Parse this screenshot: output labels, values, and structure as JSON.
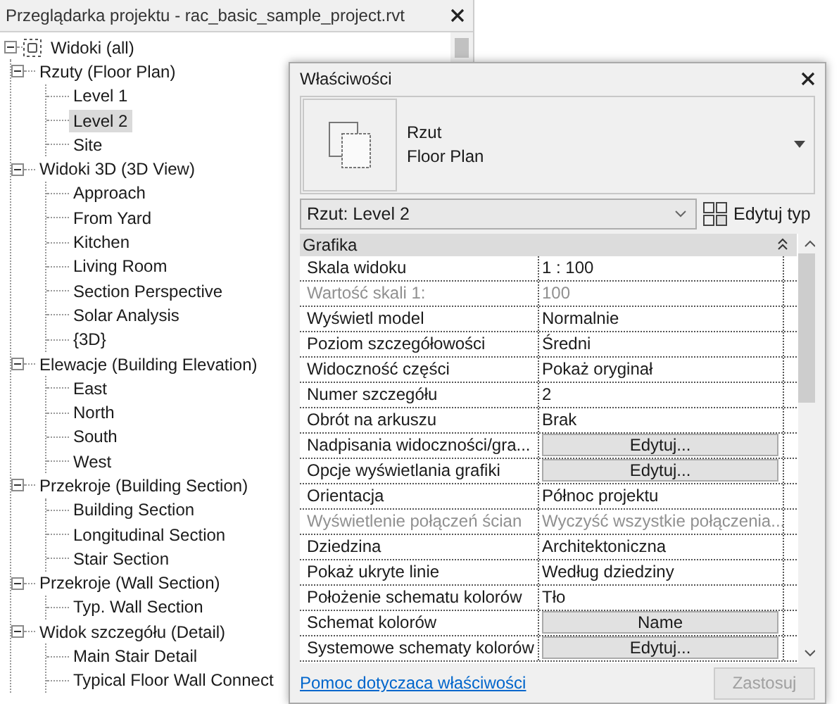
{
  "browser": {
    "title": "Przeglądarka projektu - rac_basic_sample_project.rvt",
    "tree": [
      {
        "label": "Widoki (all)",
        "expanded": true,
        "selected": false,
        "children": [
          {
            "label": "Rzuty (Floor Plan)",
            "expanded": true,
            "selected": false,
            "children": [
              {
                "label": "Level 1",
                "selected": false
              },
              {
                "label": "Level 2",
                "selected": true
              },
              {
                "label": "Site",
                "selected": false
              }
            ]
          },
          {
            "label": "Widoki 3D (3D View)",
            "expanded": true,
            "selected": false,
            "children": [
              {
                "label": "Approach",
                "selected": false
              },
              {
                "label": "From Yard",
                "selected": false
              },
              {
                "label": "Kitchen",
                "selected": false
              },
              {
                "label": "Living Room",
                "selected": false
              },
              {
                "label": "Section Perspective",
                "selected": false
              },
              {
                "label": "Solar Analysis",
                "selected": false
              },
              {
                "label": "{3D}",
                "selected": false
              }
            ]
          },
          {
            "label": "Elewacje (Building Elevation)",
            "expanded": true,
            "selected": false,
            "children": [
              {
                "label": "East",
                "selected": false
              },
              {
                "label": "North",
                "selected": false
              },
              {
                "label": "South",
                "selected": false
              },
              {
                "label": "West",
                "selected": false
              }
            ]
          },
          {
            "label": "Przekroje (Building Section)",
            "expanded": true,
            "selected": false,
            "children": [
              {
                "label": "Building Section",
                "selected": false
              },
              {
                "label": "Longitudinal Section",
                "selected": false
              },
              {
                "label": "Stair Section",
                "selected": false
              }
            ]
          },
          {
            "label": "Przekroje (Wall Section)",
            "expanded": true,
            "selected": false,
            "children": [
              {
                "label": "Typ. Wall Section",
                "selected": false
              }
            ]
          },
          {
            "label": "Widok szczegółu (Detail)",
            "expanded": true,
            "selected": false,
            "children": [
              {
                "label": "Main Stair Detail",
                "selected": false
              },
              {
                "label": "Typical Floor Wall Connect",
                "selected": false
              }
            ]
          }
        ]
      }
    ]
  },
  "properties": {
    "title": "Właściwości",
    "type": {
      "name": "Rzut",
      "family": "Floor Plan"
    },
    "instance_selector": {
      "value": "Rzut: Level 2"
    },
    "edit_type_button": "Edytuj typ",
    "groups": [
      {
        "name": "Grafika",
        "expanded": true,
        "rows": [
          {
            "name": "Skala widoku",
            "value": "1 : 100",
            "kind": "text",
            "disabled": false
          },
          {
            "name": "Wartość skali  1:",
            "value": "100",
            "kind": "text",
            "disabled": true
          },
          {
            "name": "Wyświetl model",
            "value": "Normalnie",
            "kind": "text",
            "disabled": false
          },
          {
            "name": "Poziom szczegółowości",
            "value": "Średni",
            "kind": "text",
            "disabled": false
          },
          {
            "name": "Widoczność części",
            "value": "Pokaż oryginał",
            "kind": "text",
            "disabled": false
          },
          {
            "name": "Numer szczegółu",
            "value": "2",
            "kind": "text",
            "disabled": false
          },
          {
            "name": "Obrót na arkuszu",
            "value": "Brak",
            "kind": "text",
            "disabled": false
          },
          {
            "name": "Nadpisania widoczności/gra...",
            "value": "Edytuj...",
            "kind": "button",
            "disabled": false
          },
          {
            "name": "Opcje wyświetlania grafiki",
            "value": "Edytuj...",
            "kind": "button",
            "disabled": false
          },
          {
            "name": "Orientacja",
            "value": "Północ projektu",
            "kind": "text",
            "disabled": false
          },
          {
            "name": "Wyświetlenie połączeń ścian",
            "value": "Wyczyść wszystkie połączenia...",
            "kind": "text",
            "disabled": true
          },
          {
            "name": "Dziedzina",
            "value": "Architektoniczna",
            "kind": "text",
            "disabled": false
          },
          {
            "name": "Pokaż ukryte linie",
            "value": "Według dziedziny",
            "kind": "text",
            "disabled": false
          },
          {
            "name": "Położenie schematu kolorów",
            "value": "Tło",
            "kind": "text",
            "disabled": false
          },
          {
            "name": "Schemat kolorów",
            "value": "Name",
            "kind": "button",
            "disabled": false
          },
          {
            "name": "Systemowe schematy kolorów",
            "value": "Edytuj...",
            "kind": "button",
            "disabled": false
          }
        ]
      }
    ],
    "help_link": "Pomoc dotyczaca właściwości",
    "apply_button": {
      "label": "Zastosuj",
      "disabled": true
    }
  }
}
